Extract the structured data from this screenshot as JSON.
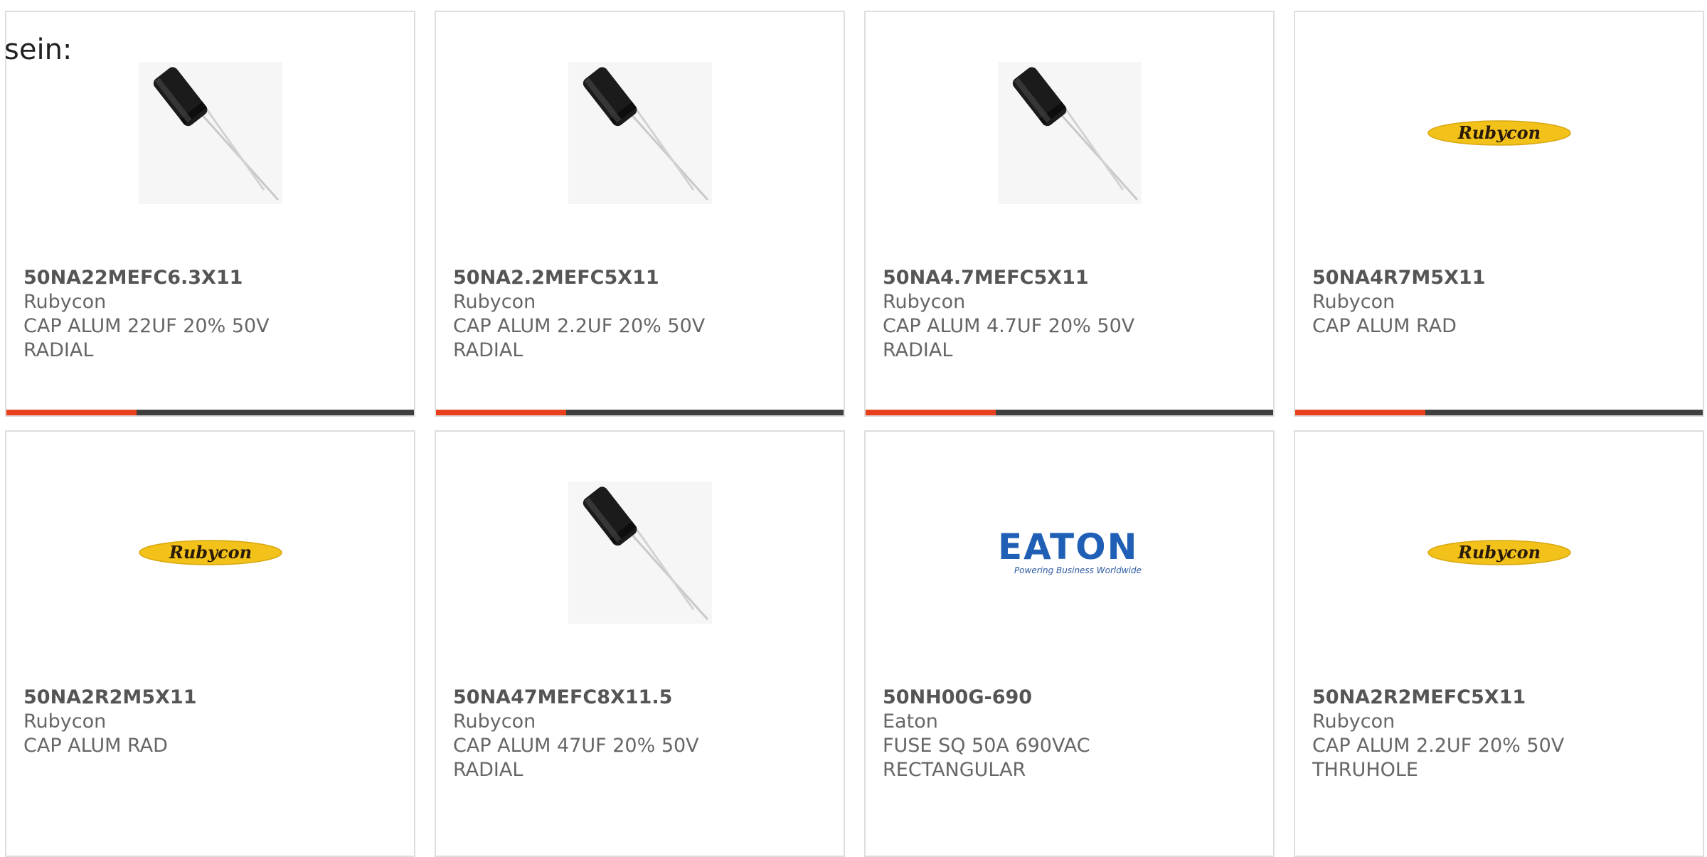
{
  "intro_text": "sein:",
  "colors": {
    "card_border": "#dedede",
    "part_text": "#555555",
    "detail_text": "#666666",
    "bar_track": "#3f3f3f",
    "bar_fill": "#e8401c"
  },
  "products": [
    {
      "part": "50NA22MEFC6.3X11",
      "manufacturer": "Rubycon",
      "description": "CAP ALUM 22UF 20% 50V RADIAL",
      "image": "capacitor-image",
      "progress": 0.32
    },
    {
      "part": "50NA2.2MEFC5X11",
      "manufacturer": "Rubycon",
      "description": "CAP ALUM 2.2UF 20% 50V RADIAL",
      "image": "capacitor-image",
      "progress": 0.32
    },
    {
      "part": "50NA4.7MEFC5X11",
      "manufacturer": "Rubycon",
      "description": "CAP ALUM 4.7UF 20% 50V RADIAL",
      "image": "capacitor-image",
      "progress": 0.32
    },
    {
      "part": "50NA4R7M5X11",
      "manufacturer": "Rubycon",
      "description": "CAP ALUM RAD",
      "image": "rubycon-logo",
      "logo_text": "Rubycon",
      "progress": 0.32
    },
    {
      "part": "50NA2R2M5X11",
      "manufacturer": "Rubycon",
      "description": "CAP ALUM RAD",
      "image": "rubycon-logo",
      "logo_text": "Rubycon"
    },
    {
      "part": "50NA47MEFC8X11.5",
      "manufacturer": "Rubycon",
      "description": "CAP ALUM 47UF 20% 50V RADIAL",
      "image": "capacitor-image"
    },
    {
      "part": "50NH00G-690",
      "manufacturer": "Eaton",
      "description": "FUSE SQ 50A 690VAC RECTANGULAR",
      "image": "eaton-logo",
      "logo_text": "EATON",
      "logo_tagline": "Powering Business Worldwide"
    },
    {
      "part": "50NA2R2MEFC5X11",
      "manufacturer": "Rubycon",
      "description": "CAP ALUM 2.2UF 20% 50V THRUHOLE",
      "image": "rubycon-logo",
      "logo_text": "Rubycon"
    }
  ]
}
